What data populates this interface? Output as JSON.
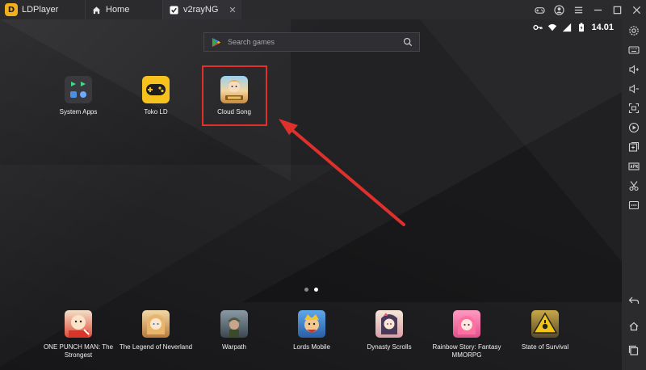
{
  "titlebar": {
    "app_name": "LDPlayer",
    "tabs": [
      {
        "label": "Home",
        "icon": "home-icon"
      },
      {
        "label": "v2rayNG",
        "icon": "v2ray-check-icon",
        "close": "✕"
      }
    ],
    "window_controls": [
      "gamepad-icon",
      "account-icon",
      "menu-icon",
      "minimize-icon",
      "maximize-icon",
      "close-icon"
    ]
  },
  "status": {
    "time": "14.01"
  },
  "search": {
    "placeholder": "Search games"
  },
  "apps": [
    {
      "label": "System Apps",
      "icon": "system-apps-icon"
    },
    {
      "label": "Toko LD",
      "icon": "toko-ld-icon"
    },
    {
      "label": "Cloud Song",
      "icon": "cloud-song-icon",
      "highlighted": true
    }
  ],
  "dock": [
    {
      "label": "ONE PUNCH MAN: The Strongest"
    },
    {
      "label": "The Legend of Neverland"
    },
    {
      "label": "Warpath"
    },
    {
      "label": "Lords Mobile"
    },
    {
      "label": "Dynasty Scrolls"
    },
    {
      "label": "Rainbow Story: Fantasy MMORPG"
    },
    {
      "label": "State of Survival"
    }
  ],
  "sidebar_icons": [
    "settings-icon",
    "keyboard-icon",
    "volume-up-icon",
    "volume-down-icon",
    "fullscreen-icon",
    "record-icon",
    "add-app-icon",
    "apk-icon",
    "scissors-icon",
    "more-icon",
    "back-icon",
    "home-icon",
    "recent-apps-icon"
  ],
  "colors": {
    "highlight": "#e0302c",
    "accent": "#f2b01e"
  }
}
